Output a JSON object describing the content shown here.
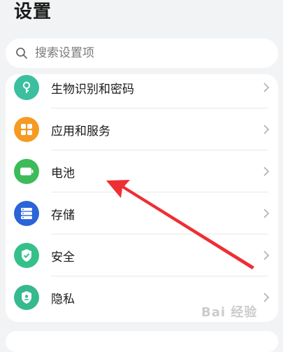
{
  "header": {
    "title": "设置"
  },
  "search": {
    "placeholder": "搜索设置项"
  },
  "settings": {
    "items": [
      {
        "label": "生物识别和密码",
        "icon": "key-icon",
        "color": "#3bbf9e"
      },
      {
        "label": "应用和服务",
        "icon": "apps-grid-icon",
        "color": "#f59a23"
      },
      {
        "label": "电池",
        "icon": "battery-icon",
        "color": "#3dbb5a"
      },
      {
        "label": "存储",
        "icon": "storage-icon",
        "color": "#2b63d9"
      },
      {
        "label": "安全",
        "icon": "shield-check-icon",
        "color": "#35c08a"
      },
      {
        "label": "隐私",
        "icon": "privacy-shield-icon",
        "color": "#36b98f"
      }
    ]
  },
  "annotation": {
    "arrow_color": "#ee2f33"
  },
  "watermark": {
    "text": "Bai 经验"
  }
}
